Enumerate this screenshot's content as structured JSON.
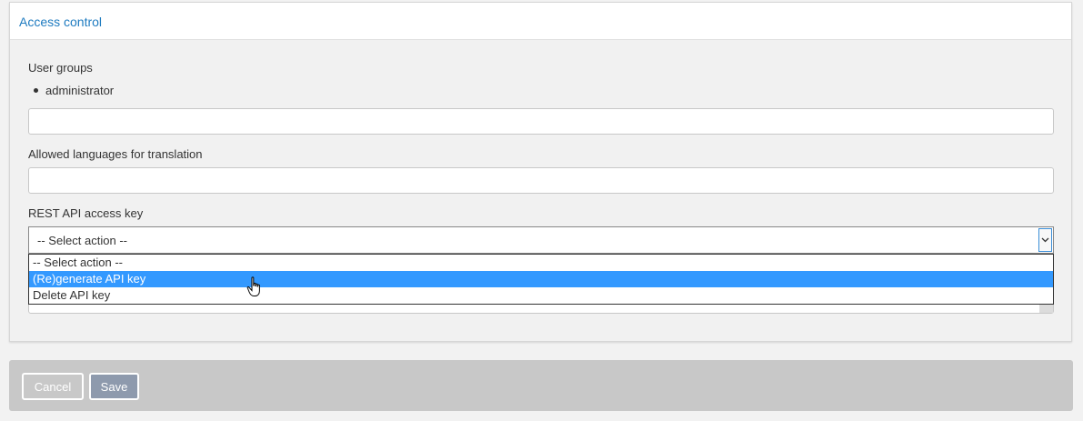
{
  "panel": {
    "title": "Access control"
  },
  "user_groups": {
    "label": "User groups",
    "items": [
      "administrator"
    ],
    "input_value": ""
  },
  "languages": {
    "label": "Allowed languages for translation",
    "input_value": ""
  },
  "rest_api": {
    "label": "REST API access key",
    "selected": "-- Select action --",
    "options": [
      "-- Select action --",
      "(Re)generate API key",
      "Delete API key"
    ],
    "highlighted_index": 1
  },
  "footer": {
    "cancel_label": "Cancel",
    "save_label": "Save"
  },
  "colors": {
    "accent": "#1e7bc0",
    "highlight": "#3399ff",
    "save_button": "#8e9aad",
    "footer_bg": "#c8c8c8"
  },
  "icons": {
    "dropdown": "chevron-down-icon",
    "cursor": "hand-pointer-icon"
  }
}
